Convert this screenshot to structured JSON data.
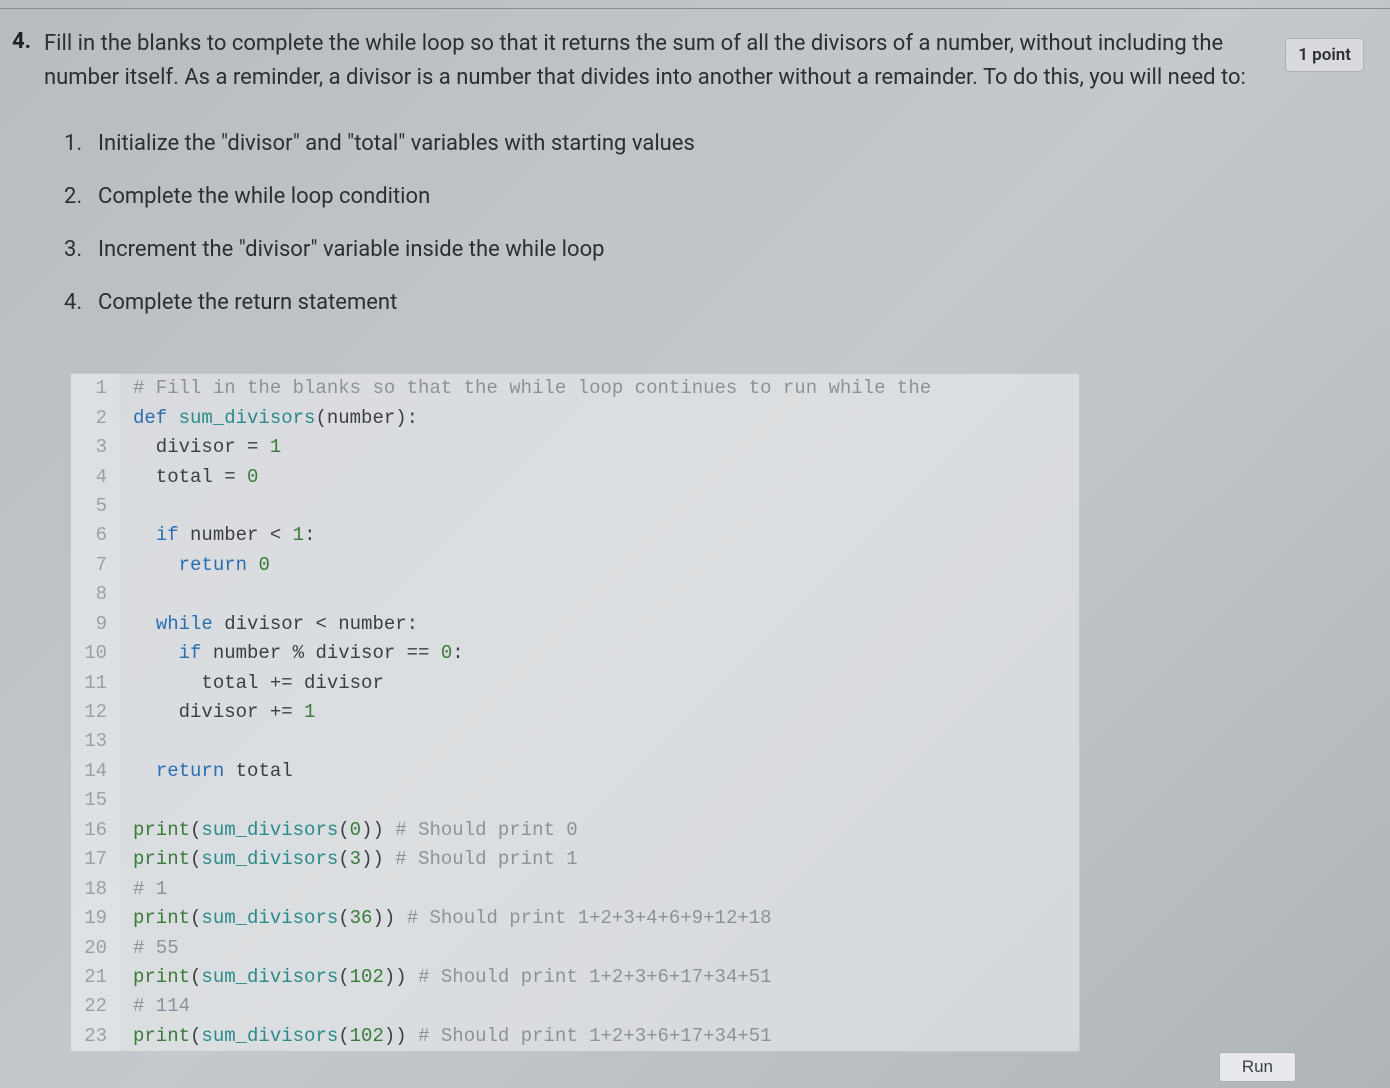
{
  "question": {
    "number": "4.",
    "prompt": "Fill in the blanks to complete the while loop so that it returns the sum of all the divisors of a number, without including the number itself. As a reminder, a divisor is a number that divides into another without a remainder. To do this, you will need to:",
    "points_label": "1 point",
    "steps": [
      {
        "n": "1.",
        "text": "Initialize the \"divisor\" and \"total\" variables with starting values"
      },
      {
        "n": "2.",
        "text": "Complete the while loop condition"
      },
      {
        "n": "3.",
        "text": "Increment the \"divisor\" variable inside the while loop"
      },
      {
        "n": "4.",
        "text": "Complete the return statement"
      }
    ]
  },
  "code": {
    "lines": [
      {
        "n": "1",
        "tokens": [
          {
            "t": "# Fill in the blanks so that the while loop continues to run while the",
            "c": "tk-comment"
          }
        ]
      },
      {
        "n": "2",
        "tokens": [
          {
            "t": "def ",
            "c": "tk-kw"
          },
          {
            "t": "sum_divisors",
            "c": "tk-id-teal"
          },
          {
            "t": "(number):",
            "c": "tk-op"
          }
        ]
      },
      {
        "n": "3",
        "tokens": [
          {
            "t": "  divisor = ",
            "c": "tk-op"
          },
          {
            "t": "1",
            "c": "tk-num"
          }
        ]
      },
      {
        "n": "4",
        "tokens": [
          {
            "t": "  total = ",
            "c": "tk-op"
          },
          {
            "t": "0",
            "c": "tk-num"
          }
        ]
      },
      {
        "n": "5",
        "tokens": [
          {
            "t": "",
            "c": "tk-op"
          }
        ]
      },
      {
        "n": "6",
        "tokens": [
          {
            "t": "  ",
            "c": "tk-op"
          },
          {
            "t": "if ",
            "c": "tk-kw"
          },
          {
            "t": "number < ",
            "c": "tk-op"
          },
          {
            "t": "1",
            "c": "tk-num"
          },
          {
            "t": ":",
            "c": "tk-op"
          }
        ]
      },
      {
        "n": "7",
        "tokens": [
          {
            "t": "    ",
            "c": "tk-op"
          },
          {
            "t": "return ",
            "c": "tk-kw"
          },
          {
            "t": "0",
            "c": "tk-num"
          }
        ]
      },
      {
        "n": "8",
        "tokens": [
          {
            "t": "",
            "c": "tk-op"
          }
        ]
      },
      {
        "n": "9",
        "tokens": [
          {
            "t": "  ",
            "c": "tk-op"
          },
          {
            "t": "while ",
            "c": "tk-kw"
          },
          {
            "t": "divisor < number:",
            "c": "tk-op"
          }
        ]
      },
      {
        "n": "10",
        "tokens": [
          {
            "t": "    ",
            "c": "tk-op"
          },
          {
            "t": "if ",
            "c": "tk-kw"
          },
          {
            "t": "number % divisor == ",
            "c": "tk-op"
          },
          {
            "t": "0",
            "c": "tk-num"
          },
          {
            "t": ":",
            "c": "tk-op"
          }
        ]
      },
      {
        "n": "11",
        "tokens": [
          {
            "t": "      total += divisor",
            "c": "tk-op"
          }
        ]
      },
      {
        "n": "12",
        "tokens": [
          {
            "t": "    divisor += ",
            "c": "tk-op"
          },
          {
            "t": "1",
            "c": "tk-num"
          }
        ]
      },
      {
        "n": "13",
        "tokens": [
          {
            "t": "",
            "c": "tk-op"
          }
        ]
      },
      {
        "n": "14",
        "tokens": [
          {
            "t": "  ",
            "c": "tk-op"
          },
          {
            "t": "return ",
            "c": "tk-kw"
          },
          {
            "t": "total",
            "c": "tk-op"
          }
        ]
      },
      {
        "n": "15",
        "tokens": [
          {
            "t": "",
            "c": "tk-op"
          }
        ]
      },
      {
        "n": "16",
        "tokens": [
          {
            "t": "print",
            "c": "tk-fn-call"
          },
          {
            "t": "(",
            "c": "tk-op"
          },
          {
            "t": "sum_divisors",
            "c": "tk-id-teal"
          },
          {
            "t": "(",
            "c": "tk-op"
          },
          {
            "t": "0",
            "c": "tk-num"
          },
          {
            "t": ")) ",
            "c": "tk-op"
          },
          {
            "t": "# Should print 0",
            "c": "tk-comment"
          }
        ]
      },
      {
        "n": "17",
        "tokens": [
          {
            "t": "print",
            "c": "tk-fn-call"
          },
          {
            "t": "(",
            "c": "tk-op"
          },
          {
            "t": "sum_divisors",
            "c": "tk-id-teal"
          },
          {
            "t": "(",
            "c": "tk-op"
          },
          {
            "t": "3",
            "c": "tk-num"
          },
          {
            "t": ")) ",
            "c": "tk-op"
          },
          {
            "t": "# Should print 1",
            "c": "tk-comment"
          }
        ]
      },
      {
        "n": "18",
        "tokens": [
          {
            "t": "# 1",
            "c": "tk-comment"
          }
        ]
      },
      {
        "n": "19",
        "tokens": [
          {
            "t": "print",
            "c": "tk-fn-call"
          },
          {
            "t": "(",
            "c": "tk-op"
          },
          {
            "t": "sum_divisors",
            "c": "tk-id-teal"
          },
          {
            "t": "(",
            "c": "tk-op"
          },
          {
            "t": "36",
            "c": "tk-num"
          },
          {
            "t": ")) ",
            "c": "tk-op"
          },
          {
            "t": "# Should print 1+2+3+4+6+9+12+18",
            "c": "tk-comment"
          }
        ]
      },
      {
        "n": "20",
        "tokens": [
          {
            "t": "# 55",
            "c": "tk-comment"
          }
        ]
      },
      {
        "n": "21",
        "tokens": [
          {
            "t": "print",
            "c": "tk-fn-call"
          },
          {
            "t": "(",
            "c": "tk-op"
          },
          {
            "t": "sum_divisors",
            "c": "tk-id-teal"
          },
          {
            "t": "(",
            "c": "tk-op"
          },
          {
            "t": "102",
            "c": "tk-num"
          },
          {
            "t": ")) ",
            "c": "tk-op"
          },
          {
            "t": "# Should print 1+2+3+6+17+34+51",
            "c": "tk-comment"
          }
        ]
      },
      {
        "n": "22",
        "tokens": [
          {
            "t": "# 114",
            "c": "tk-comment"
          }
        ]
      },
      {
        "n": "23",
        "tokens": [
          {
            "t": "print",
            "c": "tk-fn-call"
          },
          {
            "t": "(",
            "c": "tk-op"
          },
          {
            "t": "sum_divisors",
            "c": "tk-id-teal"
          },
          {
            "t": "(",
            "c": "tk-op"
          },
          {
            "t": "102",
            "c": "tk-num"
          },
          {
            "t": ")) ",
            "c": "tk-op"
          },
          {
            "t": "# Should print 1+2+3+6+17+34+51",
            "c": "tk-comment"
          }
        ]
      }
    ],
    "run_label": "Run"
  }
}
